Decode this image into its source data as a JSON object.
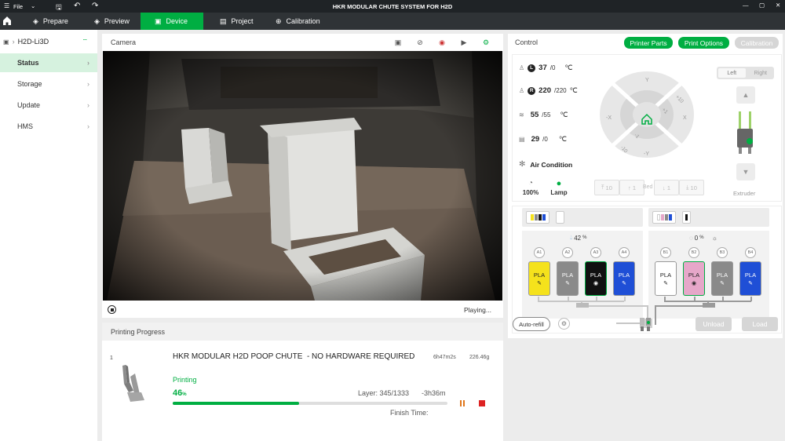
{
  "window": {
    "menu_file": "File",
    "title": "HKR MODULAR CHUTE SYSTEM FOR H2D"
  },
  "nav": {
    "tabs": [
      {
        "label": "Prepare"
      },
      {
        "label": "Preview"
      },
      {
        "label": "Device"
      },
      {
        "label": "Project"
      },
      {
        "label": "Calibration"
      }
    ],
    "active": "Device"
  },
  "sidebar": {
    "printer_name": "H2D-Li3D",
    "items": [
      {
        "label": "Status"
      },
      {
        "label": "Storage"
      },
      {
        "label": "Update"
      },
      {
        "label": "HMS"
      }
    ],
    "active": "Status"
  },
  "camera": {
    "title": "Camera",
    "status": "Playing..."
  },
  "progress": {
    "title": "Printing Progress",
    "plate": "1",
    "job_name": "HKR MODULAR H2D POOP CHUTE  - NO HARDWARE REQUIRED",
    "duration": "6h47m2s",
    "weight": "226.46g",
    "state": "Printing",
    "percent_value": "46",
    "percent_unit": "%",
    "percent_fraction": 0.46,
    "layer": "Layer: 345/1333",
    "remaining": "-3h36m",
    "finish_label": "Finish Time:"
  },
  "control": {
    "title": "Control",
    "buttons": {
      "printer_parts": "Printer Parts",
      "print_options": "Print Options",
      "calibration": "Calibration"
    },
    "left_nozzle": {
      "badge": "L",
      "current": "37",
      "target": "/0",
      "unit": "℃"
    },
    "right_nozzle": {
      "badge": "R",
      "current": "220",
      "target": "/220",
      "unit": "℃"
    },
    "bed": {
      "current": "55",
      "target": "/55",
      "unit": "℃"
    },
    "chamber": {
      "current": "29",
      "target": "/0",
      "unit": "℃"
    },
    "air_condition": "Air Condition",
    "fan": {
      "value": "100%"
    },
    "lamp": {
      "label": "Lamp"
    },
    "jog": {
      "y_pos": "Y",
      "y_neg": "-Y",
      "x_pos": "X",
      "x_neg": "-X",
      "plus10": "+10",
      "plus1": "+1",
      "minus1": "-1",
      "minus10": "-10"
    },
    "bed_buttons": {
      "up10": "10",
      "up1": "1",
      "label": "Bed",
      "down1": "1",
      "down10": "10"
    },
    "extruder": {
      "left": "Left",
      "right": "Right",
      "label": "Extruder"
    },
    "ams_left": {
      "humidity": "42",
      "humidity_unit": "%",
      "slots": [
        {
          "id": "A1",
          "material": "PLA",
          "color": "#f5e21c",
          "text_color": "#222",
          "icon": "pencil"
        },
        {
          "id": "A2",
          "material": "PLA",
          "color": "#8a8a8a",
          "text_color": "#fff",
          "icon": "pencil"
        },
        {
          "id": "A3",
          "material": "PLA",
          "color": "#111111",
          "text_color": "#fff",
          "icon": "eye"
        },
        {
          "id": "A4",
          "material": "PLA",
          "color": "#1f4fd6",
          "text_color": "#fff",
          "icon": "pencil"
        }
      ]
    },
    "ams_right": {
      "humidity": "0",
      "humidity_unit": "%",
      "slots": [
        {
          "id": "B1",
          "material": "PLA",
          "color": "#ffffff",
          "text_color": "#222",
          "icon": "pencil"
        },
        {
          "id": "B2",
          "material": "PLA",
          "color": "#e6a7c9",
          "text_color": "#222",
          "icon": "eye"
        },
        {
          "id": "B3",
          "material": "PLA",
          "color": "#8a8a8a",
          "text_color": "#fff",
          "icon": "pencil"
        },
        {
          "id": "B4",
          "material": "PLA",
          "color": "#1f4fd6",
          "text_color": "#fff",
          "icon": "pencil"
        }
      ]
    },
    "auto_refill": "Auto-refill",
    "unload": "Unload",
    "load": "Load"
  },
  "colors": {
    "accent": "#00ae42",
    "titlebar": "#1f2326",
    "navbar": "#2f3336"
  }
}
